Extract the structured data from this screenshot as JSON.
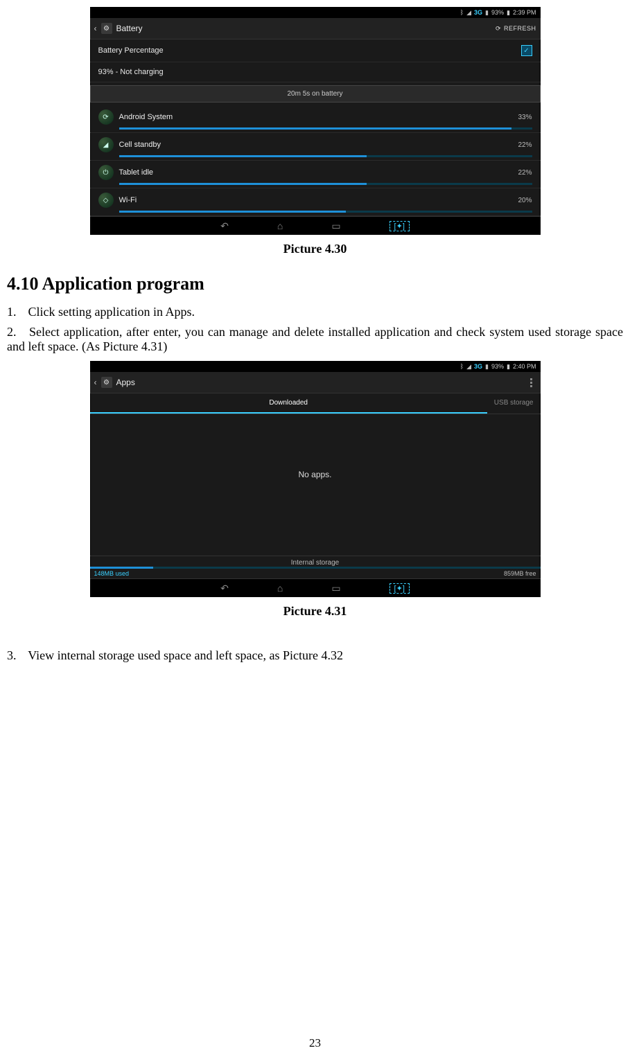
{
  "screenshot1": {
    "status": {
      "threeg": "3G",
      "battery": "93%",
      "time": "2:39 PM"
    },
    "title": "Battery",
    "refresh": "REFRESH",
    "percentage_label": "Battery Percentage",
    "charging": "93% - Not charging",
    "on_battery": "20m 5s on battery",
    "items": [
      {
        "label": "Android System",
        "pct": "33%",
        "fill": 95
      },
      {
        "label": "Cell standby",
        "pct": "22%",
        "fill": 60
      },
      {
        "label": "Tablet idle",
        "pct": "22%",
        "fill": 60
      },
      {
        "label": "Wi-Fi",
        "pct": "20%",
        "fill": 55
      }
    ]
  },
  "caption1": "Picture 4.30",
  "heading": "4.10 Application program",
  "list1_num": "1.",
  "list1": "Click setting application in Apps.",
  "list2_num": "2.",
  "list2": "Select application, after enter, you can manage and delete installed application and check system used storage space and left space. (As Picture 4.31)",
  "screenshot2": {
    "status": {
      "threeg": "3G",
      "battery": "93%",
      "time": "2:40 PM"
    },
    "title": "Apps",
    "tab_left": "Downloaded",
    "tab_right": "USB storage",
    "noapps": "No apps.",
    "storage_label": "Internal storage",
    "used": "148MB used",
    "free": "859MB free"
  },
  "caption2": "Picture 4.31",
  "list3_num": "3.",
  "list3": "View internal storage used space and left space, as Picture 4.32",
  "pagenum": "23"
}
